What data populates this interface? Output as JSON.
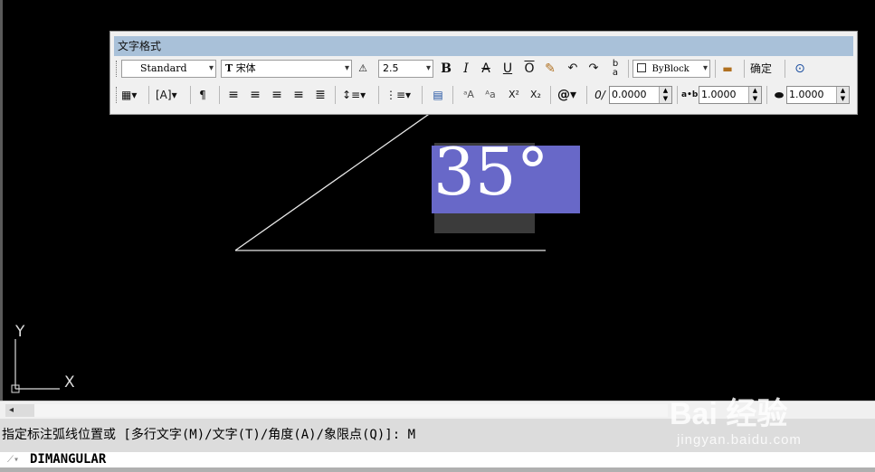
{
  "toolbar": {
    "title": "文字格式",
    "style_value": "Standard",
    "font_value": "宋体",
    "height_value": "2.5",
    "bold": "B",
    "italic": "I",
    "strike": "A",
    "underline": "U",
    "overline": "O",
    "color_value": "ByBlock",
    "ok_label": "确定",
    "oblique_value": "0.0000",
    "tracking_value": "1.0000",
    "width_value": "1.0000",
    "symbol_label": "@",
    "oblique_icon": "0/",
    "tracking_icon": "a•b"
  },
  "drawing": {
    "mtext": "35°",
    "ucs_x": "X",
    "ucs_y": "Y"
  },
  "command": {
    "history": "指定标注弧线位置或 [多行文字(M)/文字(T)/角度(A)/象限点(Q)]: M",
    "input": "DIMANGULAR"
  },
  "watermark": {
    "main": "Bai 经验",
    "sub": "jingyan.baidu.com"
  },
  "colors": {
    "canvas": "#000000",
    "text_highlight": "#6868c8",
    "title_bar": "#a9c1d9"
  }
}
